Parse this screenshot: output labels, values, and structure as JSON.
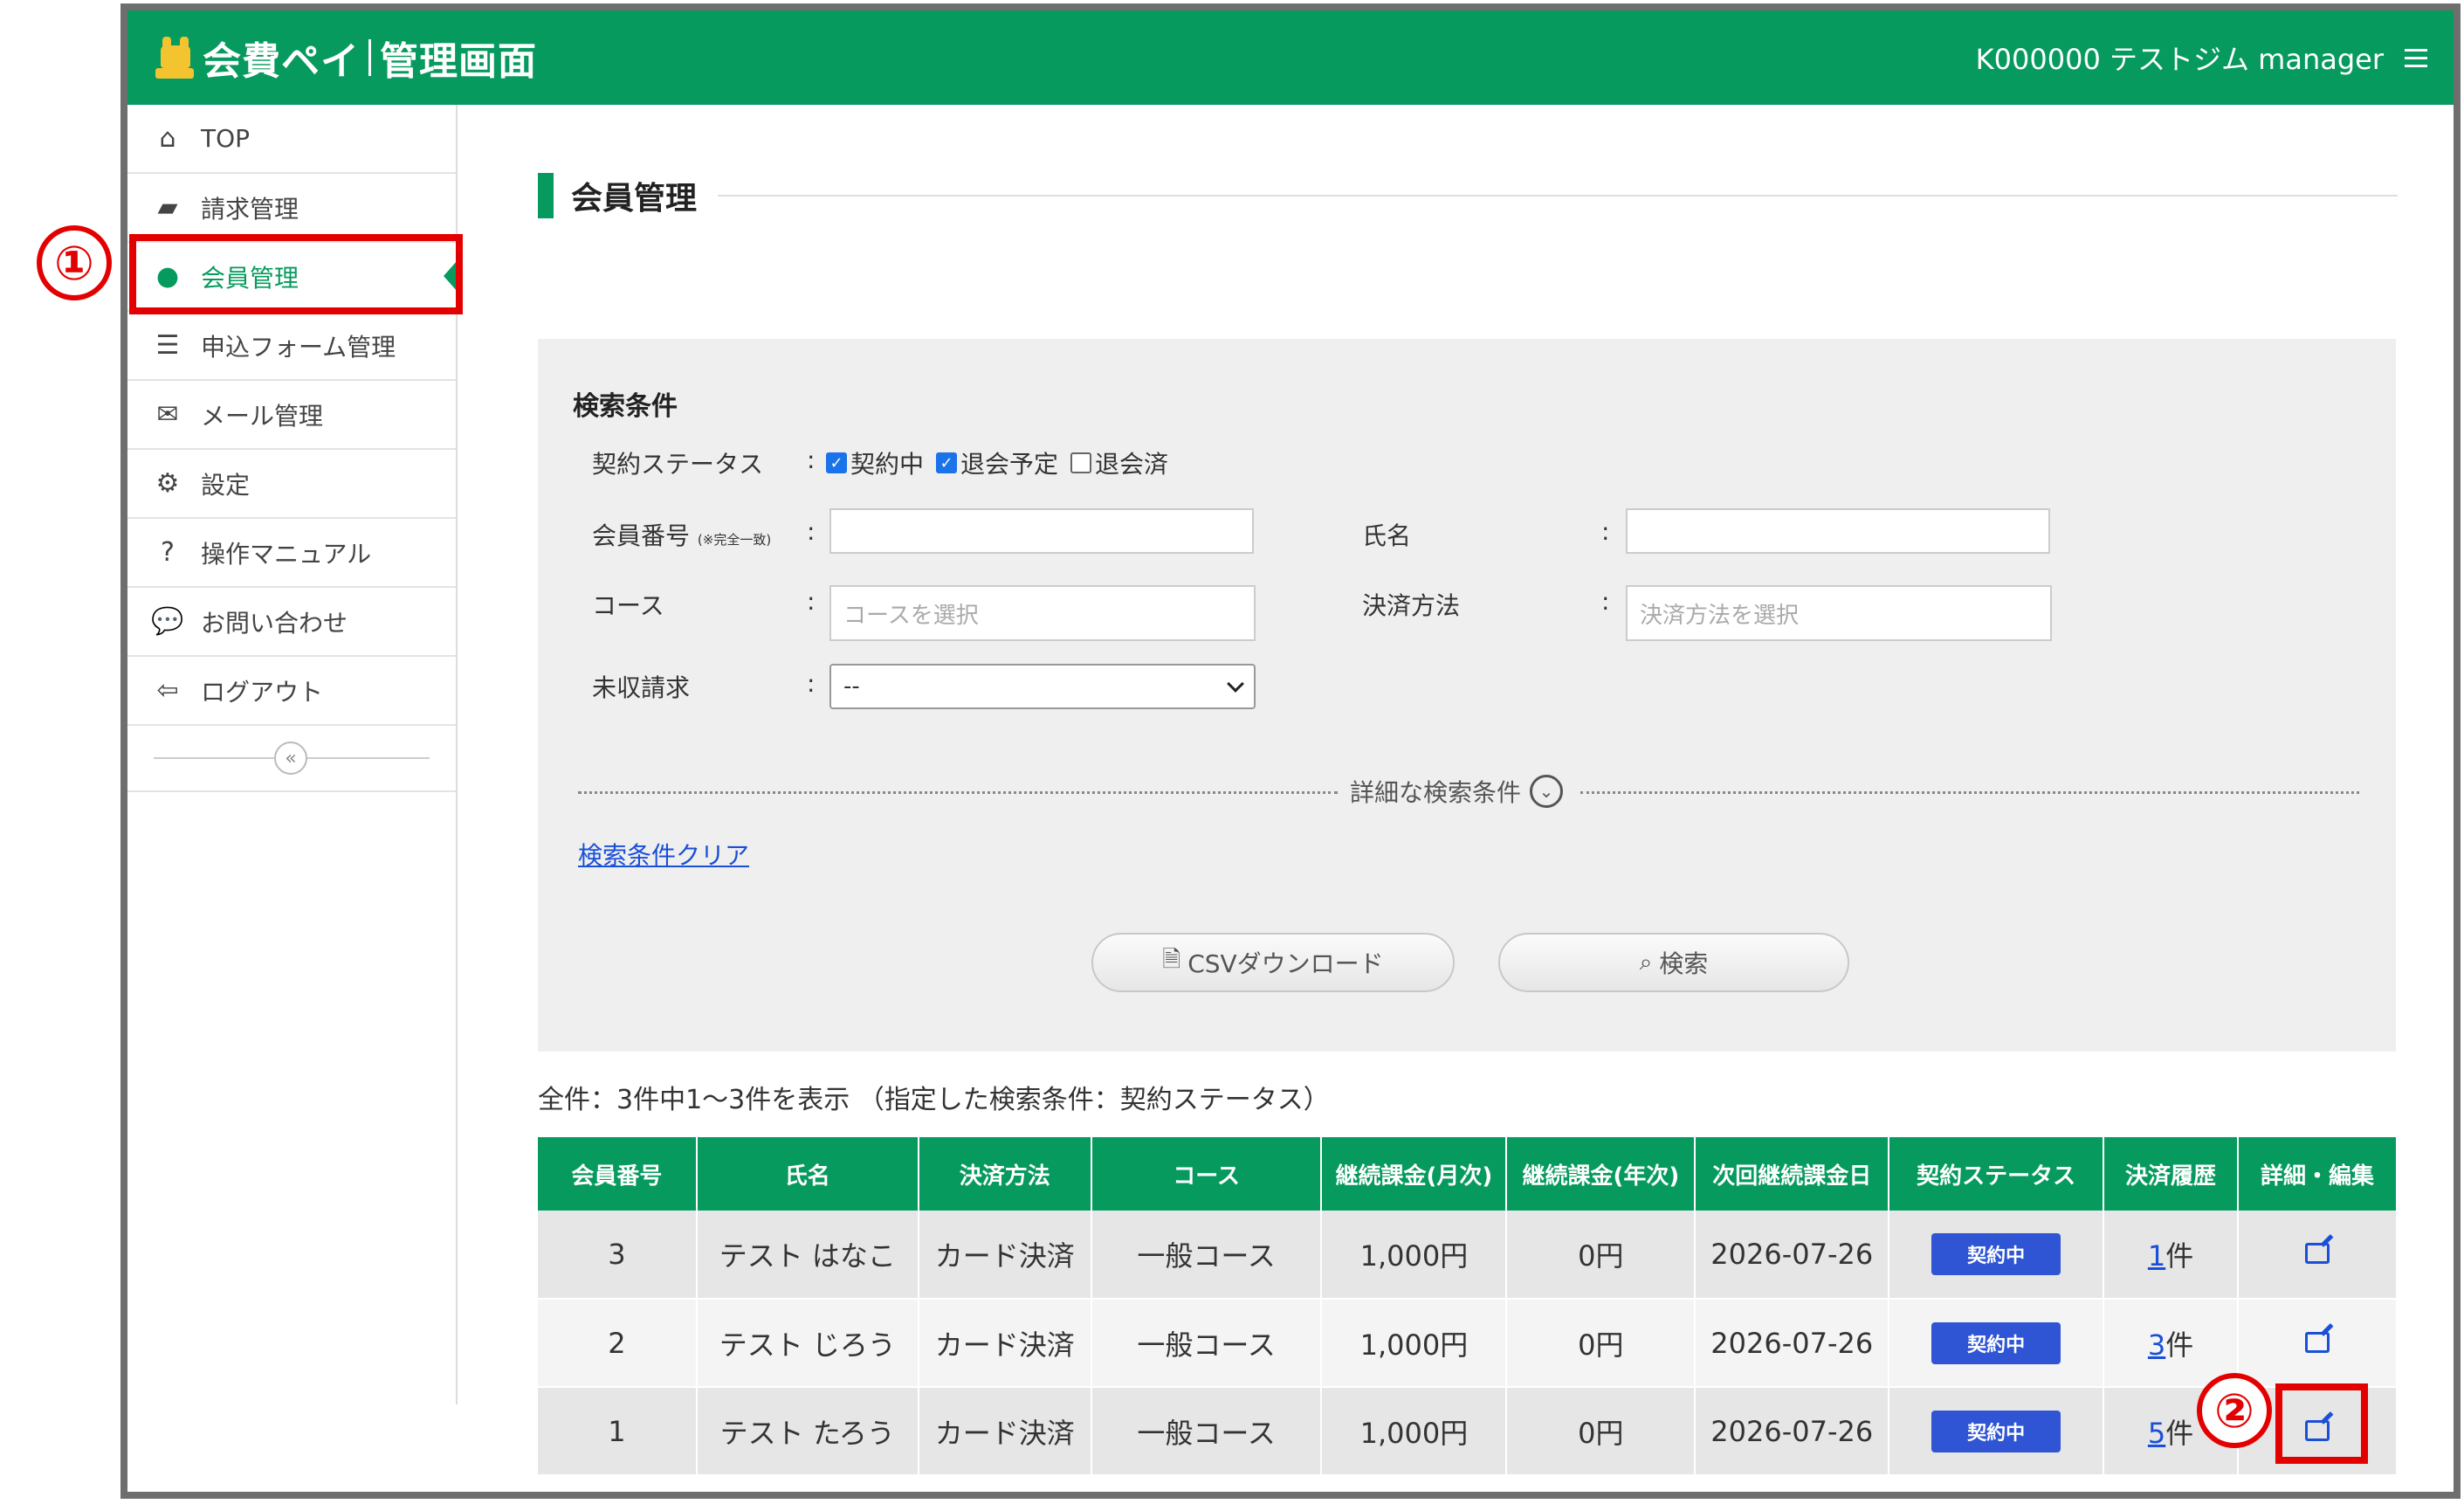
{
  "header": {
    "logo_brand": "会費ペイ",
    "logo_sub": "管理画面",
    "account": "K000000 テストジム manager",
    "menu_icon": "hamburger-icon"
  },
  "sidebar": {
    "items": [
      {
        "label": "TOP",
        "icon": "home-icon"
      },
      {
        "label": "請求管理",
        "icon": "book-icon"
      },
      {
        "label": "会員管理",
        "icon": "user-icon"
      },
      {
        "label": "申込フォーム管理",
        "icon": "list-icon"
      },
      {
        "label": "メール管理",
        "icon": "envelope-icon"
      },
      {
        "label": "設定",
        "icon": "gears-icon"
      },
      {
        "label": "操作マニュアル",
        "icon": "question-icon"
      },
      {
        "label": "お問い合わせ",
        "icon": "comments-icon"
      },
      {
        "label": "ログアウト",
        "icon": "sign-out-icon"
      }
    ],
    "collapse_glyph": "«"
  },
  "page": {
    "title": "会員管理"
  },
  "search": {
    "title": "検索条件",
    "status_label": "契約ステータス",
    "status_options": [
      {
        "label": "契約中",
        "checked": true
      },
      {
        "label": "退会予定",
        "checked": true
      },
      {
        "label": "退会済",
        "checked": false
      }
    ],
    "member_no_label": "会員番号",
    "member_no_note": "(※完全一致)",
    "member_no_value": "",
    "name_label": "氏名",
    "name_value": "",
    "course_label": "コース",
    "course_placeholder": "コースを選択",
    "payment_label": "決済方法",
    "payment_placeholder": "決済方法を選択",
    "unpaid_label": "未収請求",
    "unpaid_value": "--",
    "colon": ":",
    "advanced": "詳細な検索条件",
    "clear": "検索条件クリア",
    "csv_button": "CSVダウンロード",
    "search_button": "検索"
  },
  "summary": "全件：3件中1～3件を表示 （指定した検索条件：契約ステータス）",
  "table": {
    "headers": [
      "会員番号",
      "氏名",
      "決済方法",
      "コース",
      "継続課金(月次)",
      "継続課金(年次)",
      "次回継続課金日",
      "契約ステータス",
      "決済履歴",
      "詳細・編集"
    ],
    "rows": [
      {
        "no": "3",
        "name": "テスト はなこ",
        "payment": "カード決済",
        "course": "一般コース",
        "monthly": "1,000円",
        "yearly": "0円",
        "next": "2026-07-26",
        "status": "契約中",
        "hist_count": "1",
        "hist_unit": "件"
      },
      {
        "no": "2",
        "name": "テスト じろう",
        "payment": "カード決済",
        "course": "一般コース",
        "monthly": "1,000円",
        "yearly": "0円",
        "next": "2026-07-26",
        "status": "契約中",
        "hist_count": "3",
        "hist_unit": "件"
      },
      {
        "no": "1",
        "name": "テスト たろう",
        "payment": "カード決済",
        "course": "一般コース",
        "monthly": "1,000円",
        "yearly": "0円",
        "next": "2026-07-26",
        "status": "契約中",
        "hist_count": "5",
        "hist_unit": "件"
      }
    ]
  },
  "annotations": {
    "one": "①",
    "two": "②",
    "color": "#e30000"
  },
  "colors": {
    "brand_green": "#069a5e",
    "badge_blue": "#2f55d4",
    "link_blue": "#1a4fd8"
  }
}
